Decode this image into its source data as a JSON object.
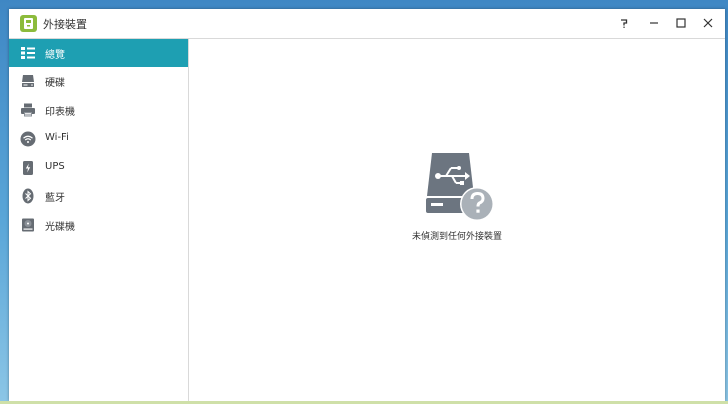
{
  "window": {
    "title": "外接裝置"
  },
  "sidebar": {
    "items": [
      {
        "label": "總覽",
        "icon": "overview-list-icon",
        "active": true
      },
      {
        "label": "硬碟",
        "icon": "hard-disk-icon",
        "active": false
      },
      {
        "label": "印表機",
        "icon": "printer-icon",
        "active": false
      },
      {
        "label": "Wi-Fi",
        "icon": "wifi-icon",
        "active": false
      },
      {
        "label": "UPS",
        "icon": "ups-icon",
        "active": false
      },
      {
        "label": "藍牙",
        "icon": "bluetooth-icon",
        "active": false
      },
      {
        "label": "光碟機",
        "icon": "optical-drive-icon",
        "active": false
      }
    ]
  },
  "content": {
    "empty_message": "未偵測到任何外接裝置",
    "illustration_icon": "usb-drive-unknown-icon"
  },
  "colors": {
    "accent": "#1e9fb2",
    "app_icon": "#8cbb3c",
    "illustration": "#6c7580"
  }
}
